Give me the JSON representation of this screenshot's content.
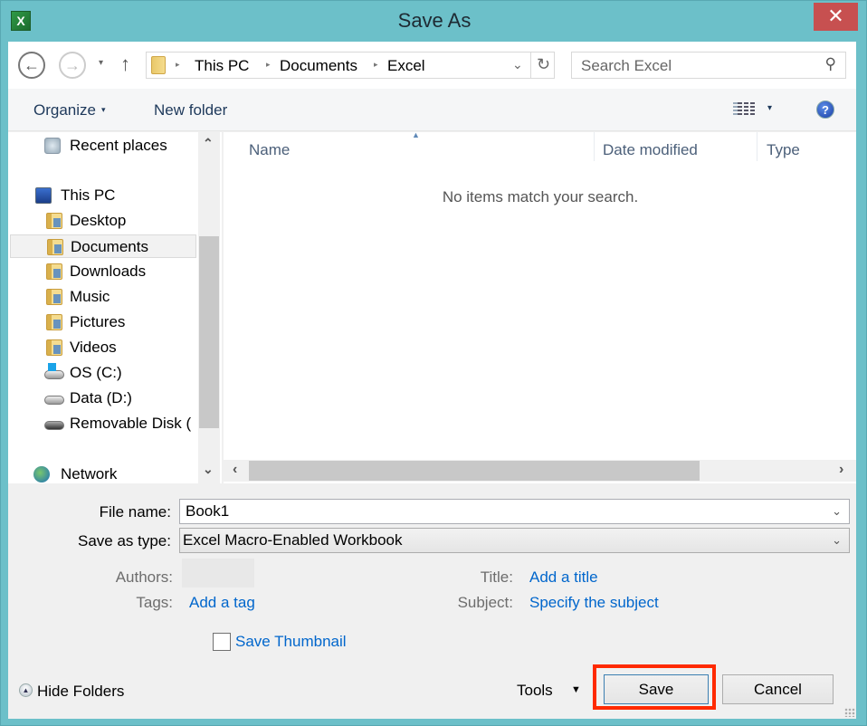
{
  "window": {
    "title": "Save As",
    "app_icon": "excel-icon",
    "close_label": "✕"
  },
  "navbar": {
    "back_icon": "←",
    "forward_icon": "→",
    "recent_icon": "▾",
    "up_icon": "↑",
    "breadcrumb": [
      "This PC",
      "Documents",
      "Excel"
    ],
    "crumb_separator": "▸",
    "dropdown_icon": "⌄",
    "refresh_icon": "↻",
    "search_placeholder": "Search Excel",
    "search_icon": "⚲"
  },
  "toolbar": {
    "organize_label": "Organize",
    "caret": "▾",
    "new_folder_label": "New folder",
    "help_icon": "?"
  },
  "nav_pane": {
    "items": [
      {
        "label": "Recent places",
        "icon": "recent-places-icon"
      },
      {
        "label": "This PC",
        "icon": "computer-icon"
      },
      {
        "label": "Desktop",
        "icon": "desktop-folder-icon"
      },
      {
        "label": "Documents",
        "icon": "documents-folder-icon",
        "selected": true
      },
      {
        "label": "Downloads",
        "icon": "downloads-folder-icon"
      },
      {
        "label": "Music",
        "icon": "music-folder-icon"
      },
      {
        "label": "Pictures",
        "icon": "pictures-folder-icon"
      },
      {
        "label": "Videos",
        "icon": "videos-folder-icon"
      },
      {
        "label": "OS (C:)",
        "icon": "os-drive-icon"
      },
      {
        "label": "Data (D:)",
        "icon": "data-drive-icon"
      },
      {
        "label": "Removable Disk (",
        "icon": "removable-disk-icon"
      },
      {
        "label": "Network",
        "icon": "network-icon"
      }
    ],
    "scroll_up": "⌃",
    "scroll_down": "⌄"
  },
  "file_list": {
    "columns": [
      "Name",
      "Date modified",
      "Type"
    ],
    "sort_indicator": "▲",
    "empty_message": "No items match your search.",
    "scroll_left": "‹",
    "scroll_right": "›"
  },
  "form": {
    "file_name_label": "File name:",
    "file_name_value": "Book1",
    "save_type_label": "Save as type:",
    "save_type_value": "Excel Macro-Enabled Workbook",
    "dropdown_icon": "⌄",
    "authors_label": "Authors:",
    "tags_label": "Tags:",
    "tags_link": "Add a tag",
    "title_label": "Title:",
    "title_link": "Add a title",
    "subject_label": "Subject:",
    "subject_link": "Specify the subject",
    "save_thumbnail_label": "Save Thumbnail",
    "save_thumbnail_checked": false
  },
  "footer": {
    "hide_folders_icon": "▲",
    "hide_folders_label": "Hide Folders",
    "tools_label": "Tools",
    "tools_caret": "▼",
    "save_label": "Save",
    "cancel_label": "Cancel"
  },
  "colors": {
    "frame": "#6cc0c9",
    "close": "#c75050",
    "link": "#0066cc",
    "highlight": "#ff2a00"
  }
}
